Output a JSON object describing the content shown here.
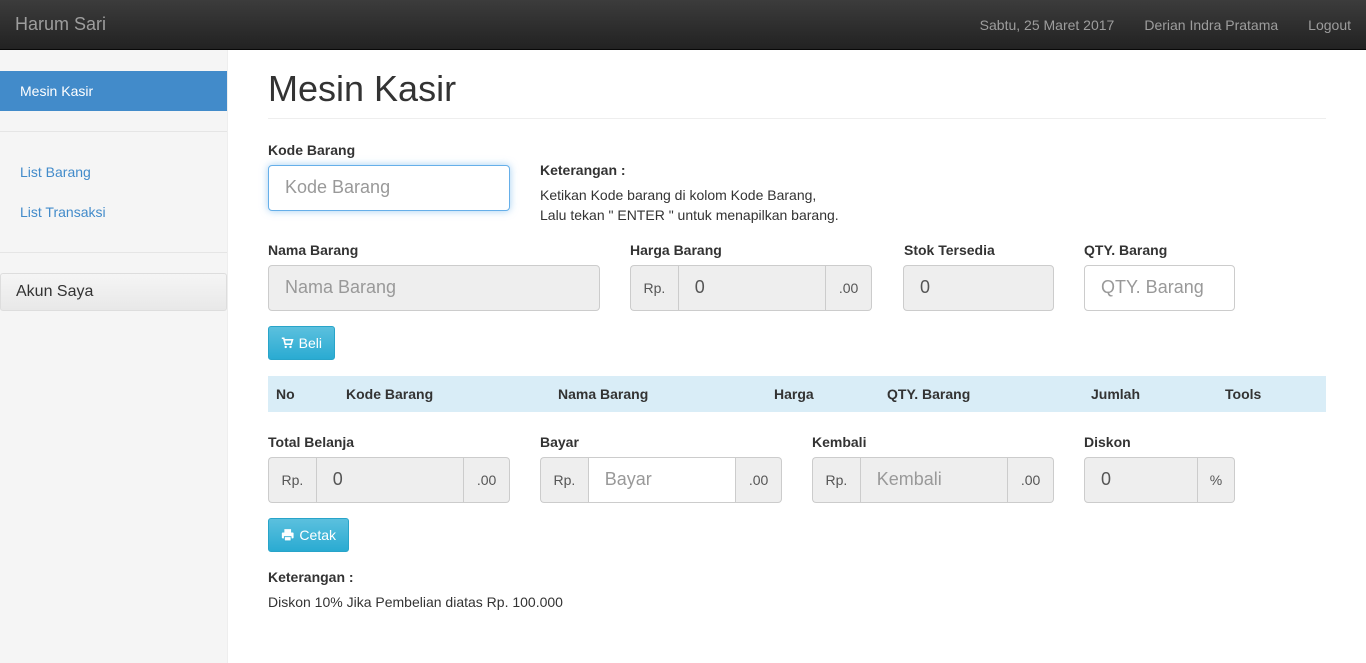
{
  "navbar": {
    "brand": "Harum Sari",
    "date": "Sabtu, 25 Maret 2017",
    "user": "Derian Indra Pratama",
    "logout": "Logout"
  },
  "sidebar": {
    "active": "Mesin Kasir",
    "items": [
      "List Barang",
      "List Transaksi"
    ],
    "panel": "Akun Saya"
  },
  "page": {
    "title": "Mesin Kasir"
  },
  "form": {
    "kode_label": "Kode Barang",
    "kode_placeholder": "Kode Barang",
    "info_title": "Keterangan :",
    "info_line1": "Ketikan Kode barang di kolom Kode Barang,",
    "info_line2": "Lalu tekan \" ENTER \" untuk menapilkan barang.",
    "nama_label": "Nama Barang",
    "nama_placeholder": "Nama Barang",
    "harga_label": "Harga Barang",
    "harga_value": "0",
    "stok_label": "Stok Tersedia",
    "stok_value": "0",
    "qty_label": "QTY. Barang",
    "qty_placeholder": "QTY. Barang",
    "rp": "Rp.",
    "cents": ".00",
    "beli_button": "Beli"
  },
  "table": {
    "headers": [
      "No",
      "Kode Barang",
      "Nama Barang",
      "Harga",
      "QTY. Barang",
      "Jumlah",
      "Tools"
    ]
  },
  "payment": {
    "total_label": "Total Belanja",
    "total_value": "0",
    "bayar_label": "Bayar",
    "bayar_placeholder": "Bayar",
    "kembali_label": "Kembali",
    "kembali_placeholder": "Kembali",
    "diskon_label": "Diskon",
    "diskon_value": "0",
    "percent": "%",
    "cetak_button": "Cetak"
  },
  "footer_note": {
    "title": "Keterangan :",
    "text": "Diskon 10% Jika Pembelian diatas Rp. 100.000"
  },
  "colors": {
    "primary": "#428bca",
    "info": "#5bc0de",
    "navbar": "#222222",
    "table_head": "#d9edf7"
  }
}
